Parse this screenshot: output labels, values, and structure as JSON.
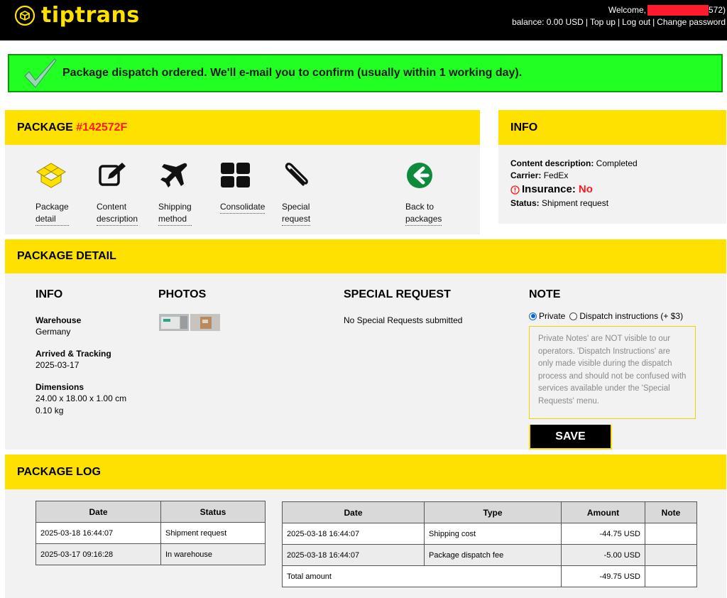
{
  "header": {
    "logo_text": "tiptrans",
    "welcome": "Welcome,",
    "user_suffix": "572)",
    "balance": "balance: 0.00 USD",
    "links": [
      "Top up",
      "Log out",
      "Change password"
    ]
  },
  "banner": {
    "message": "Package dispatch ordered. We'll e-mail you to confirm (usually within 1 working day)."
  },
  "package_panel": {
    "title_prefix": "PACKAGE ",
    "number": "#142572F",
    "nav": [
      {
        "line1": "Package",
        "line2": "detail",
        "icon": "box-icon"
      },
      {
        "line1": "Content",
        "line2": "description",
        "icon": "edit-icon"
      },
      {
        "line1": "Shipping",
        "line2": "method",
        "icon": "airplane-icon"
      },
      {
        "line1": "Consolidate",
        "line2": "",
        "icon": "grid-icon"
      },
      {
        "line1": "Special",
        "line2": "request",
        "icon": "paperclip-icon"
      },
      {
        "line1": "Back to",
        "line2": "packages",
        "icon": "back-arrow-icon"
      }
    ]
  },
  "info_panel": {
    "title": "INFO",
    "content_label": "Content description:",
    "content_value": " Completed",
    "carrier_label": "Carrier:",
    "carrier_value": " FedEx",
    "insurance_label": "Insurance:",
    "insurance_value": "No",
    "status_label": "Status:",
    "status_value": " Shipment request"
  },
  "detail_panel": {
    "title": "PACKAGE DETAIL",
    "info_title": "INFO",
    "warehouse_label": "Warehouse",
    "warehouse_value": "Germany",
    "arrived_label": "Arrived & Tracking",
    "arrived_value": "2025-03-17",
    "dimensions_label": "Dimensions",
    "dimensions_value": "24.00 x 18.00 x 1.00 cm",
    "weight_value": "0.10 kg",
    "photos_title": "PHOTOS",
    "special_title": "SPECIAL REQUEST",
    "special_value": "No Special Requests submitted",
    "note_title": "NOTE",
    "radio_private": "Private",
    "radio_dispatch": "Dispatch instructions (+ $3)",
    "note_placeholder": "Private Notes' are NOT visible to our operators. 'Dispatch Instructions' are only made visible during the dispatch process and should not be confused with services available under the 'Special Requests' menu.",
    "save_label": "SAVE"
  },
  "log_panel": {
    "title": "PACKAGE LOG",
    "status_table": {
      "headers": [
        "Date",
        "Status"
      ],
      "rows": [
        [
          "2025-03-18 16:44:07",
          "Shipment request"
        ],
        [
          "2025-03-17 09:16:28",
          "In warehouse"
        ]
      ]
    },
    "payment_table": {
      "headers": [
        "Date",
        "Type",
        "Amount",
        "Note"
      ],
      "rows": [
        [
          "2025-03-18 16:44:07",
          "Shipping cost",
          "-44.75 USD",
          ""
        ],
        [
          "2025-03-18 16:44:07",
          "Package dispatch fee",
          "-5.00 USD",
          ""
        ]
      ],
      "total_label": "Total amount",
      "total_value": "-49.75 USD"
    }
  },
  "colors": {
    "brand_yellow": "#ffe100",
    "success_green": "#22ff22",
    "alert_red": "#ff1a1a",
    "back_green": "#0e8a3c"
  }
}
